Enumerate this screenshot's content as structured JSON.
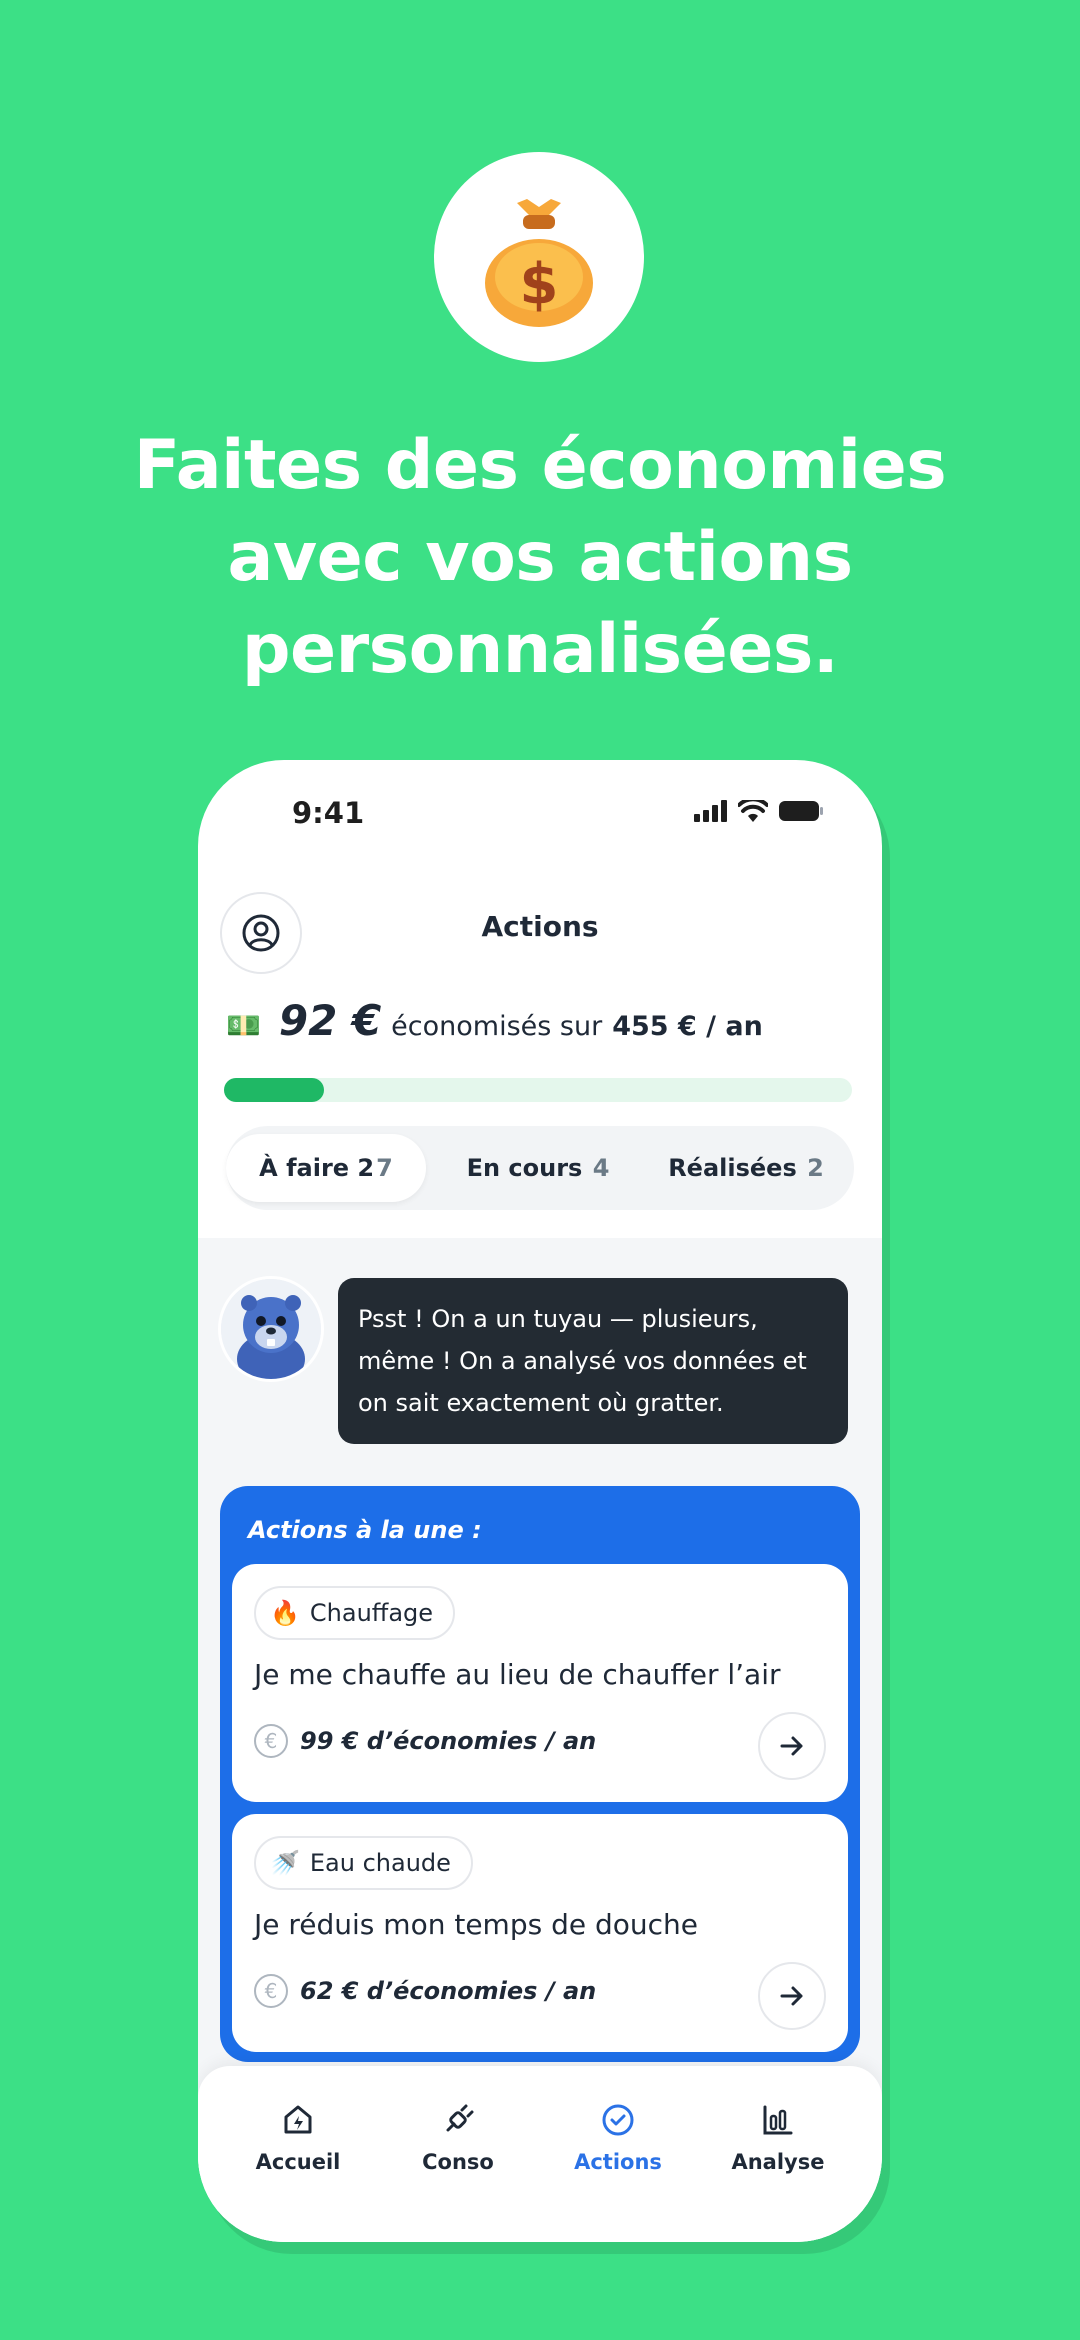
{
  "hero": {
    "icon": "money-bag-icon",
    "title_line1": "Faites des économies",
    "title_line2": "avec vos actions",
    "title_line3": "personnalisées."
  },
  "status_bar": {
    "time": "9:41"
  },
  "header": {
    "title": "Actions",
    "profile_icon": "user-circle-icon"
  },
  "savings": {
    "amount": "92 €",
    "text": "économisés sur",
    "total": "455 € / an",
    "progress_fraction": 0.16
  },
  "tabs": [
    {
      "label": "À faire 2",
      "count": "7",
      "active": true
    },
    {
      "label": "En cours",
      "count": "4",
      "active": false
    },
    {
      "label": "Réalisées",
      "count": "2",
      "active": false
    }
  ],
  "mascot_message": "Psst ! On a un tuyau — plusieurs, même ! On a analysé vos données et on sait exactement où gratter.",
  "featured": {
    "title": "Actions à la une :",
    "cards": [
      {
        "tag": "Chauffage",
        "tag_icon": "fire-icon",
        "title": "Je me chauffe au lieu de chauffer l’air",
        "saving": "99 € d’économies / an"
      },
      {
        "tag": "Eau chaude",
        "tag_icon": "shower-icon",
        "title": "Je réduis mon temps de douche",
        "saving": "62 € d’économies / an"
      }
    ]
  },
  "nav": [
    {
      "label": "Accueil",
      "icon": "home-icon"
    },
    {
      "label": "Conso",
      "icon": "plug-icon"
    },
    {
      "label": "Actions",
      "icon": "check-circle-icon",
      "active": true
    },
    {
      "label": "Analyse",
      "icon": "bar-chart-icon"
    }
  ],
  "colors": {
    "background": "#3CE086",
    "accent_blue": "#1D6EE8",
    "progress": "#1FB865",
    "bubble": "#232B33"
  }
}
